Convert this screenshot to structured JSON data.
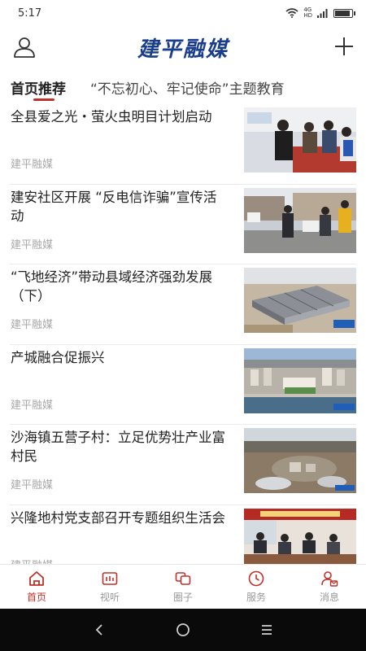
{
  "status_bar": {
    "time": "5:17",
    "network": "4G",
    "network_sub": "HD"
  },
  "header": {
    "title": "建平融媒"
  },
  "tabs": [
    {
      "label": "首页推荐"
    },
    {
      "label": "“不忘初心、牢记使命”主题教育"
    }
  ],
  "news": [
    {
      "title": "全县爱之光・萤火虫明目计划启动",
      "source": "建平融媒"
    },
    {
      "title": "建安社区开展 “反电信诈骗”宣传活动",
      "source": "建平融媒"
    },
    {
      "title": "“飞地经济”带动县域经济强劲发展（下）",
      "source": "建平融媒"
    },
    {
      "title": "产城融合促振兴",
      "source": "建平融媒"
    },
    {
      "title": "沙海镇五营子村：立足优势壮产业富村民",
      "source": "建平融媒"
    },
    {
      "title": "兴隆地村党支部召开专题组织生活会",
      "source": "建平融媒"
    }
  ],
  "bottom_nav": [
    {
      "label": "首页",
      "icon": "home-icon"
    },
    {
      "label": "视听",
      "icon": "tv-icon"
    },
    {
      "label": "圈子",
      "icon": "circle-chat-icon"
    },
    {
      "label": "服务",
      "icon": "clock-icon"
    },
    {
      "label": "消息",
      "icon": "person-message-icon"
    }
  ],
  "colors": {
    "accent": "#c0302a",
    "logo": "#1a3e8c",
    "source_text": "#a8a8a8"
  }
}
